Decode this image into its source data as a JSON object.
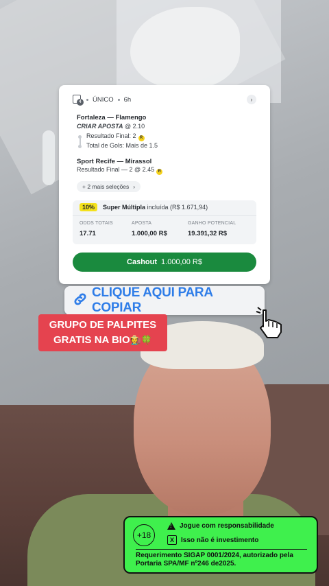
{
  "bet_card": {
    "count_badge": "4",
    "type_label": "ÚNICO",
    "time_ago": "6h",
    "match1": "Fortaleza — Flamengo",
    "create_bet_label": "CRIAR APOSTA",
    "create_bet_odds": "@ 2.10",
    "selection1": "Resultado Final: 2",
    "selection2": "Total de Gols: Mais de 1.5",
    "badge_symbol": "R",
    "match2": "Sport Recife — Mirassol",
    "match2_selection": "Resultado Final — 2 @ 2.45",
    "more_selections": "+ 2 mais seleções",
    "boost_percent": "10%",
    "boost_name": "Super Múltipla",
    "boost_included": "incluída (R$ 1.671,94)",
    "stats": [
      {
        "label": "ODDS TOTAIS",
        "value": "17.71"
      },
      {
        "label": "APOSTA",
        "value": "1.000,00 R$"
      },
      {
        "label": "GANHO POTENCIAL",
        "value": "19.391,32 R$"
      }
    ],
    "cashout_label": "Cashout",
    "cashout_amount": "1.000,00 R$",
    "accent_color": "#1a8a3e"
  },
  "copy_link": {
    "text": "CLIQUE AQUI PARA COPIAR",
    "icon": "link-icon",
    "color": "#2f7de8"
  },
  "promo": {
    "line1": "GRUPO DE PALPITES",
    "line2": "GRATIS NA BIO",
    "emojis": "🧑‍🌾🍀",
    "color": "#e5434f"
  },
  "responsibility": {
    "age": "+18",
    "line1": "Jogue com responsabilidade",
    "line2": "Isso não é investimento",
    "requirement": "Requerimento SIGAP 0001/2024, autorizado pela Portaria SPA/MF nº246 de2025.",
    "color": "#3ff04d"
  }
}
